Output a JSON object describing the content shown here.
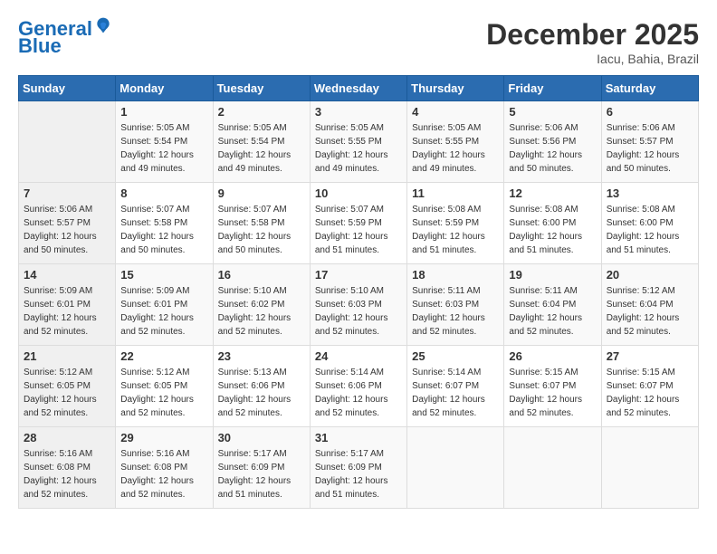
{
  "logo": {
    "line1": "General",
    "line2": "Blue"
  },
  "title": "December 2025",
  "location": "Iacu, Bahia, Brazil",
  "days_header": [
    "Sunday",
    "Monday",
    "Tuesday",
    "Wednesday",
    "Thursday",
    "Friday",
    "Saturday"
  ],
  "weeks": [
    [
      {
        "day": "",
        "sunrise": "",
        "sunset": "",
        "daylight": ""
      },
      {
        "day": "1",
        "sunrise": "5:05 AM",
        "sunset": "5:54 PM",
        "daylight": "12 hours and 49 minutes."
      },
      {
        "day": "2",
        "sunrise": "5:05 AM",
        "sunset": "5:54 PM",
        "daylight": "12 hours and 49 minutes."
      },
      {
        "day": "3",
        "sunrise": "5:05 AM",
        "sunset": "5:55 PM",
        "daylight": "12 hours and 49 minutes."
      },
      {
        "day": "4",
        "sunrise": "5:05 AM",
        "sunset": "5:55 PM",
        "daylight": "12 hours and 49 minutes."
      },
      {
        "day": "5",
        "sunrise": "5:06 AM",
        "sunset": "5:56 PM",
        "daylight": "12 hours and 50 minutes."
      },
      {
        "day": "6",
        "sunrise": "5:06 AM",
        "sunset": "5:57 PM",
        "daylight": "12 hours and 50 minutes."
      }
    ],
    [
      {
        "day": "7",
        "sunrise": "5:06 AM",
        "sunset": "5:57 PM",
        "daylight": "12 hours and 50 minutes."
      },
      {
        "day": "8",
        "sunrise": "5:07 AM",
        "sunset": "5:58 PM",
        "daylight": "12 hours and 50 minutes."
      },
      {
        "day": "9",
        "sunrise": "5:07 AM",
        "sunset": "5:58 PM",
        "daylight": "12 hours and 50 minutes."
      },
      {
        "day": "10",
        "sunrise": "5:07 AM",
        "sunset": "5:59 PM",
        "daylight": "12 hours and 51 minutes."
      },
      {
        "day": "11",
        "sunrise": "5:08 AM",
        "sunset": "5:59 PM",
        "daylight": "12 hours and 51 minutes."
      },
      {
        "day": "12",
        "sunrise": "5:08 AM",
        "sunset": "6:00 PM",
        "daylight": "12 hours and 51 minutes."
      },
      {
        "day": "13",
        "sunrise": "5:08 AM",
        "sunset": "6:00 PM",
        "daylight": "12 hours and 51 minutes."
      }
    ],
    [
      {
        "day": "14",
        "sunrise": "5:09 AM",
        "sunset": "6:01 PM",
        "daylight": "12 hours and 52 minutes."
      },
      {
        "day": "15",
        "sunrise": "5:09 AM",
        "sunset": "6:01 PM",
        "daylight": "12 hours and 52 minutes."
      },
      {
        "day": "16",
        "sunrise": "5:10 AM",
        "sunset": "6:02 PM",
        "daylight": "12 hours and 52 minutes."
      },
      {
        "day": "17",
        "sunrise": "5:10 AM",
        "sunset": "6:03 PM",
        "daylight": "12 hours and 52 minutes."
      },
      {
        "day": "18",
        "sunrise": "5:11 AM",
        "sunset": "6:03 PM",
        "daylight": "12 hours and 52 minutes."
      },
      {
        "day": "19",
        "sunrise": "5:11 AM",
        "sunset": "6:04 PM",
        "daylight": "12 hours and 52 minutes."
      },
      {
        "day": "20",
        "sunrise": "5:12 AM",
        "sunset": "6:04 PM",
        "daylight": "12 hours and 52 minutes."
      }
    ],
    [
      {
        "day": "21",
        "sunrise": "5:12 AM",
        "sunset": "6:05 PM",
        "daylight": "12 hours and 52 minutes."
      },
      {
        "day": "22",
        "sunrise": "5:12 AM",
        "sunset": "6:05 PM",
        "daylight": "12 hours and 52 minutes."
      },
      {
        "day": "23",
        "sunrise": "5:13 AM",
        "sunset": "6:06 PM",
        "daylight": "12 hours and 52 minutes."
      },
      {
        "day": "24",
        "sunrise": "5:14 AM",
        "sunset": "6:06 PM",
        "daylight": "12 hours and 52 minutes."
      },
      {
        "day": "25",
        "sunrise": "5:14 AM",
        "sunset": "6:07 PM",
        "daylight": "12 hours and 52 minutes."
      },
      {
        "day": "26",
        "sunrise": "5:15 AM",
        "sunset": "6:07 PM",
        "daylight": "12 hours and 52 minutes."
      },
      {
        "day": "27",
        "sunrise": "5:15 AM",
        "sunset": "6:07 PM",
        "daylight": "12 hours and 52 minutes."
      }
    ],
    [
      {
        "day": "28",
        "sunrise": "5:16 AM",
        "sunset": "6:08 PM",
        "daylight": "12 hours and 52 minutes."
      },
      {
        "day": "29",
        "sunrise": "5:16 AM",
        "sunset": "6:08 PM",
        "daylight": "12 hours and 52 minutes."
      },
      {
        "day": "30",
        "sunrise": "5:17 AM",
        "sunset": "6:09 PM",
        "daylight": "12 hours and 51 minutes."
      },
      {
        "day": "31",
        "sunrise": "5:17 AM",
        "sunset": "6:09 PM",
        "daylight": "12 hours and 51 minutes."
      },
      {
        "day": "",
        "sunrise": "",
        "sunset": "",
        "daylight": ""
      },
      {
        "day": "",
        "sunrise": "",
        "sunset": "",
        "daylight": ""
      },
      {
        "day": "",
        "sunrise": "",
        "sunset": "",
        "daylight": ""
      }
    ]
  ]
}
